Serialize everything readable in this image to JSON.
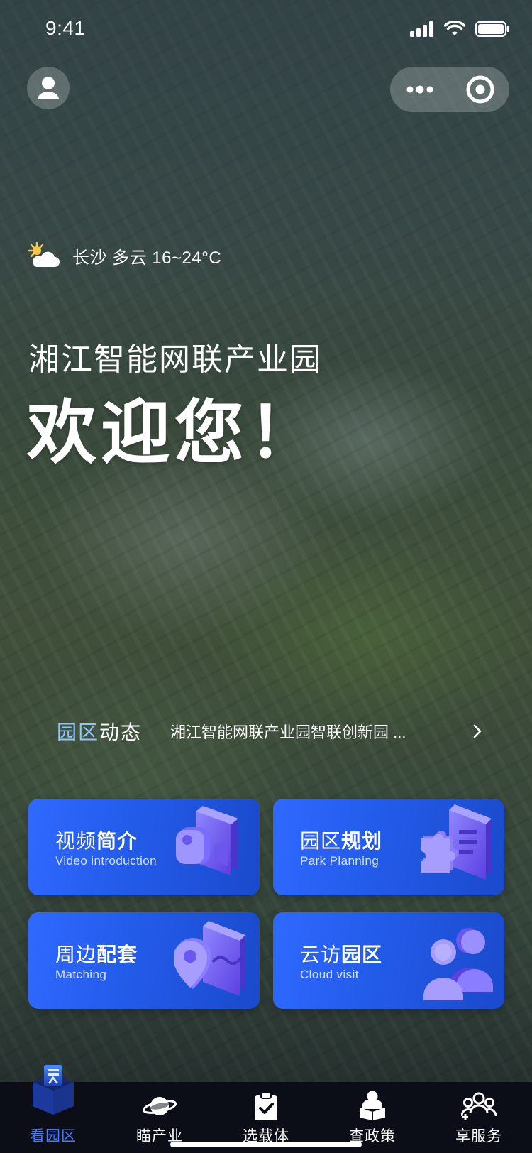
{
  "status_bar": {
    "time": "9:41"
  },
  "weather": {
    "text": "长沙 多云 16~24°C",
    "icon": "partly-cloudy-icon"
  },
  "hero": {
    "park_name": "湘江智能网联产业园",
    "welcome": "欢迎您！"
  },
  "news": {
    "label_highlight": "园区",
    "label_rest": "动态",
    "headline": "湘江智能网联产业园智联创新园 ..."
  },
  "cards": [
    {
      "title_light": "视频",
      "title_bold": "简介",
      "subtitle": "Video introduction",
      "icon": "video-camera-icon"
    },
    {
      "title_light": "园区",
      "title_bold": "规划",
      "subtitle": "Park Planning",
      "icon": "puzzle-plan-icon"
    },
    {
      "title_light": "周边",
      "title_bold": "配套",
      "subtitle": "Matching",
      "icon": "location-map-icon"
    },
    {
      "title_light": "云访",
      "title_bold": "园区",
      "subtitle": "Cloud visit",
      "icon": "people-group-icon"
    }
  ],
  "tabbar": {
    "active_index": 0,
    "items": [
      {
        "label": "看园区",
        "icon": "park-view-icon"
      },
      {
        "label": "瞄产业",
        "icon": "planet-icon"
      },
      {
        "label": "选载体",
        "icon": "clipboard-check-icon"
      },
      {
        "label": "查政策",
        "icon": "reading-person-icon"
      },
      {
        "label": "享服务",
        "icon": "team-service-icon"
      }
    ]
  },
  "colors": {
    "accent": "#3f7bff",
    "card_blue": "#235be9",
    "tabbar_bg": "#0b0e17"
  }
}
